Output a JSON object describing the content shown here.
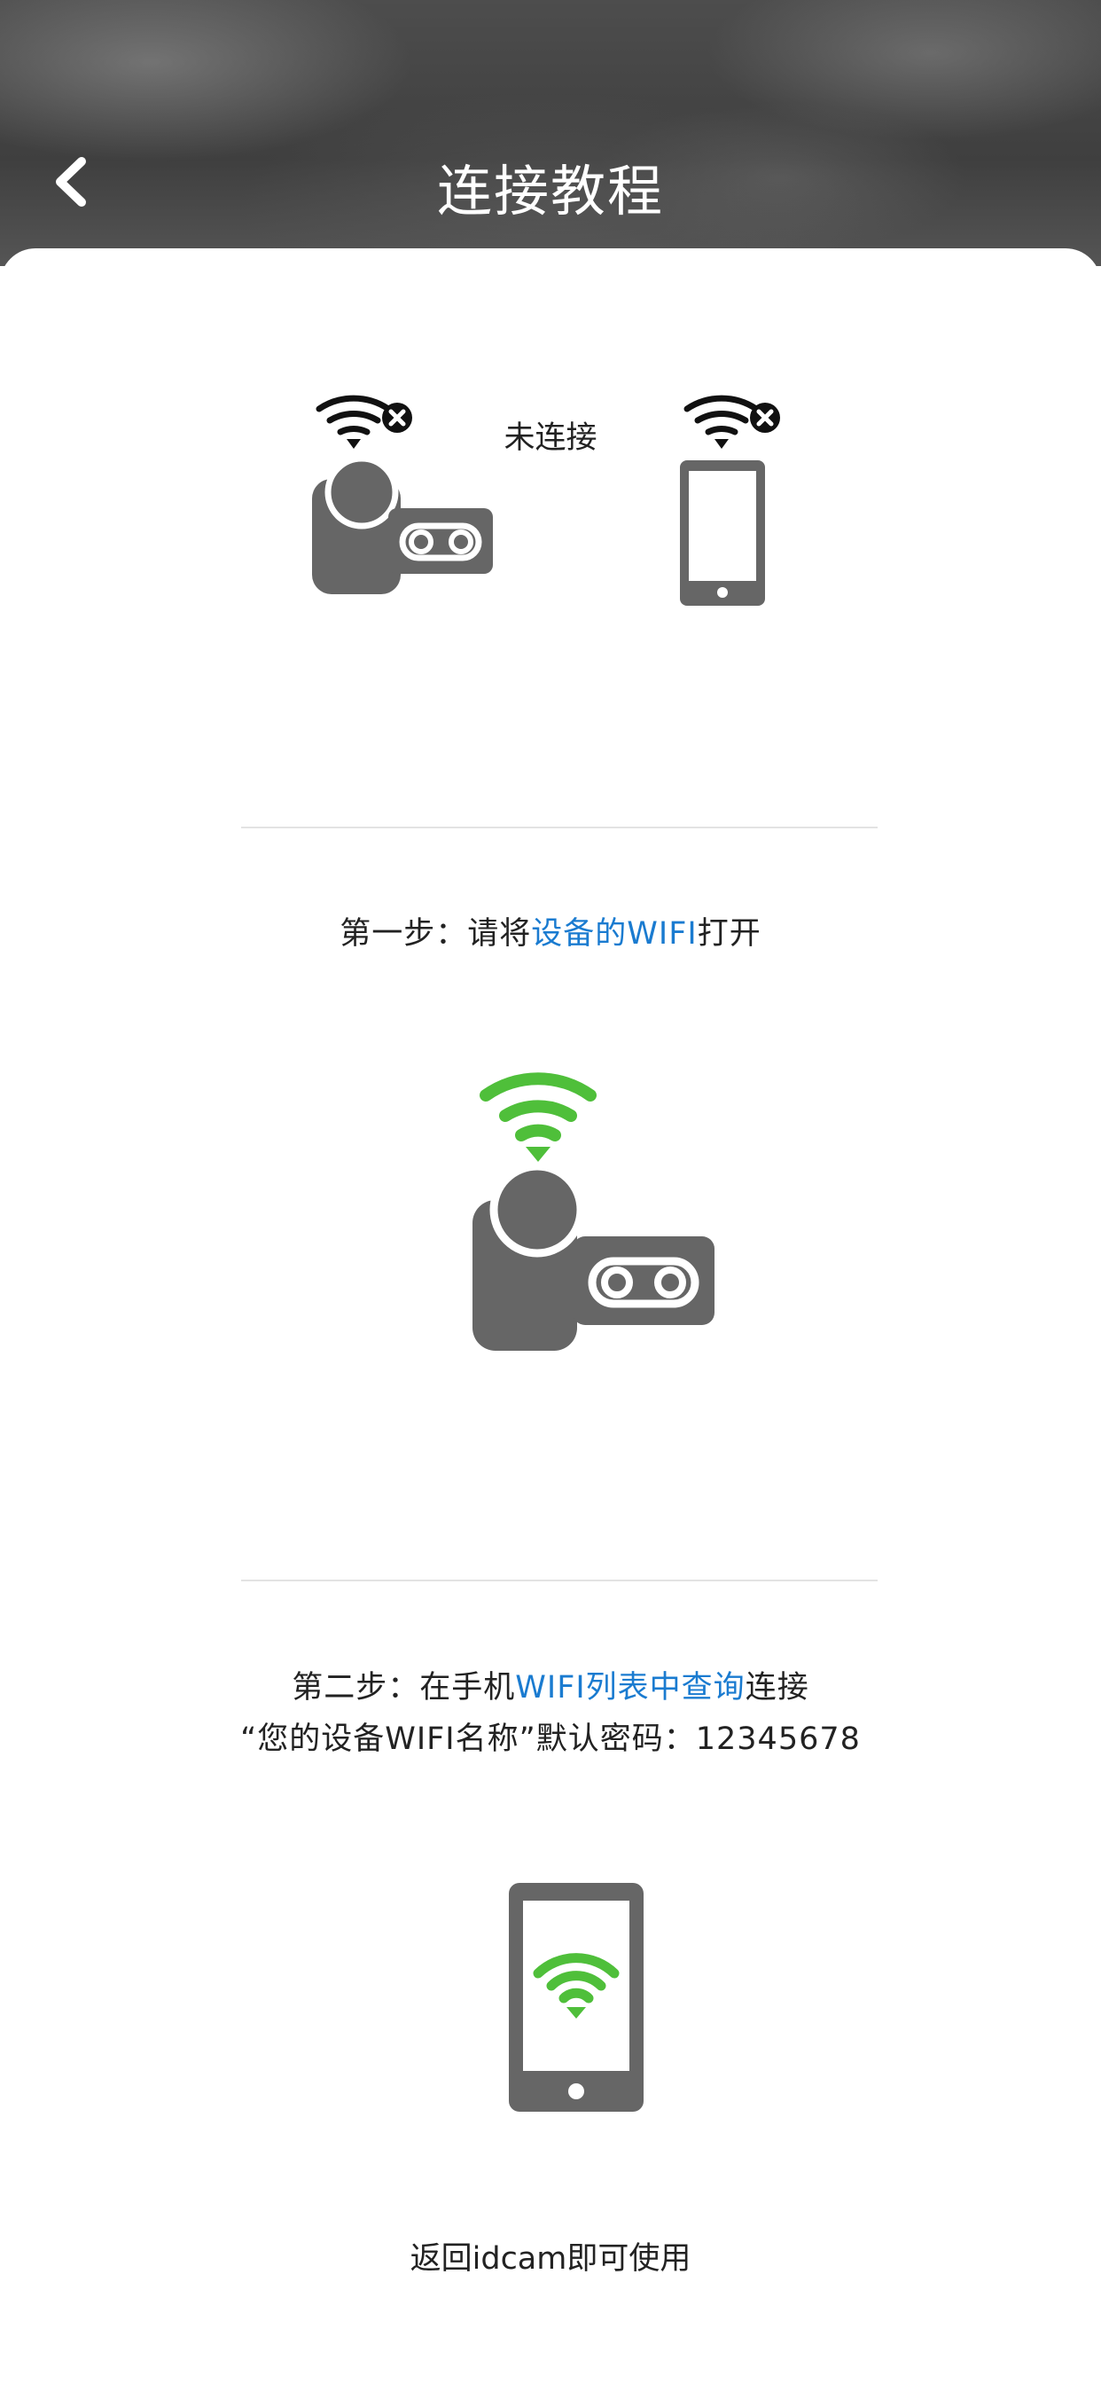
{
  "header": {
    "title": "连接教程",
    "back_icon": "chevron-left-icon"
  },
  "status": {
    "camera_icon": "video-camera-icon",
    "phone_icon": "smartphone-icon",
    "wifi_off_icon": "wifi-disconnected-icon",
    "label": "未连接"
  },
  "step1": {
    "prefix": "第一步：请将",
    "highlight": "设备的WIFI",
    "suffix": "打开",
    "wifi_icon": "wifi-icon",
    "camera_icon": "video-camera-icon"
  },
  "step2": {
    "line1_prefix": "第二步：在手机",
    "line1_highlight": "WIFI列表中查询",
    "line1_suffix": "连接",
    "line2": "“您的设备WIFI名称”默认密码：12345678",
    "phone_icon": "smartphone-wifi-icon"
  },
  "final": {
    "text": "返回idcam即可使用"
  },
  "colors": {
    "highlight": "#1a7bd0",
    "wifi_on": "#4fbf3a",
    "icon_gray": "#666666",
    "divider": "#e3e3e3"
  }
}
